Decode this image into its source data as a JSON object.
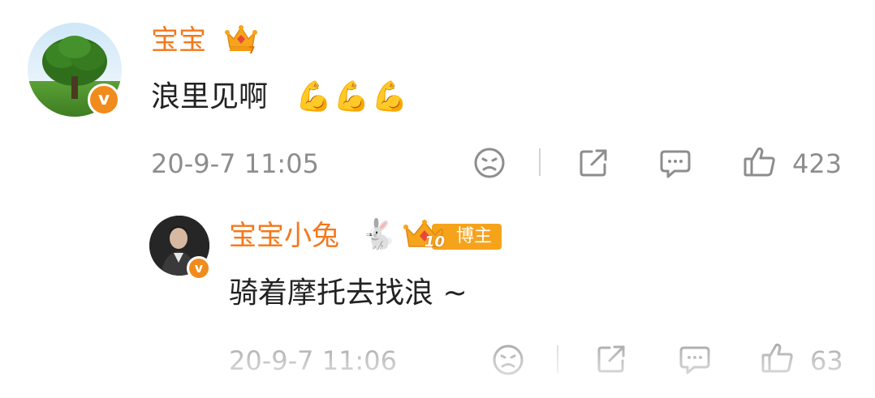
{
  "comment": {
    "username": "宝宝",
    "text": "浪里见啊",
    "emoji": "💪💪💪",
    "timestamp": "20-9-7 11:05",
    "like_count": "423",
    "icons": [
      "crown-icon",
      "verified-icon",
      "dislike-icon",
      "share-icon",
      "reply-icon",
      "like-icon"
    ]
  },
  "reply": {
    "username": "宝宝小兔",
    "username_emoji": "🐇",
    "level_badge": "10",
    "role_tag": "博主",
    "text": "骑着摩托去找浪 ~",
    "timestamp": "20-9-7 11:06",
    "like_count": "63",
    "icons": [
      "crown-level-icon",
      "verified-icon",
      "dislike-icon",
      "share-icon",
      "reply-icon",
      "like-icon"
    ]
  },
  "colors": {
    "username": "#f4781c",
    "verified_badge": "#f08b1c",
    "meta_text": "#8d8d8d",
    "body_text": "#222222",
    "blogger_tag": "#f6a31c"
  }
}
